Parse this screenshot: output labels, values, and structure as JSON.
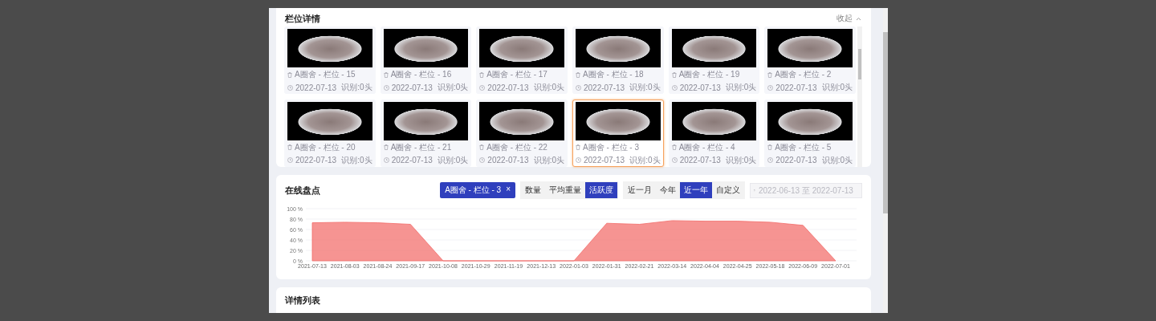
{
  "pen_details": {
    "title": "栏位详情",
    "collapse_label": "收起",
    "pens": [
      {
        "name": "A圈舍 - 栏位 - 15",
        "date": "2022-07-13",
        "count": "识别:0头",
        "selected": false
      },
      {
        "name": "A圈舍 - 栏位 - 16",
        "date": "2022-07-13",
        "count": "识别:0头",
        "selected": false
      },
      {
        "name": "A圈舍 - 栏位 - 17",
        "date": "2022-07-13",
        "count": "识别:0头",
        "selected": false
      },
      {
        "name": "A圈舍 - 栏位 - 18",
        "date": "2022-07-13",
        "count": "识别:0头",
        "selected": false
      },
      {
        "name": "A圈舍 - 栏位 - 19",
        "date": "2022-07-13",
        "count": "识别:0头",
        "selected": false
      },
      {
        "name": "A圈舍 - 栏位 - 2",
        "date": "2022-07-13",
        "count": "识别:0头",
        "selected": false
      },
      {
        "name": "A圈舍 - 栏位 - 20",
        "date": "2022-07-13",
        "count": "识别:0头",
        "selected": false
      },
      {
        "name": "A圈舍 - 栏位 - 21",
        "date": "2022-07-13",
        "count": "识别:0头",
        "selected": false
      },
      {
        "name": "A圈舍 - 栏位 - 22",
        "date": "2022-07-13",
        "count": "识别:0头",
        "selected": false
      },
      {
        "name": "A圈舍 - 栏位 - 3",
        "date": "2022-07-13",
        "count": "识别:0头",
        "selected": true
      },
      {
        "name": "A圈舍 - 栏位 - 4",
        "date": "2022-07-13",
        "count": "识别:0头",
        "selected": false
      },
      {
        "name": "A圈舍 - 栏位 - 5",
        "date": "2022-07-13",
        "count": "识别:0头",
        "selected": false
      }
    ]
  },
  "inventory": {
    "title": "在线盘点",
    "filter_chip": {
      "label": "A圈舍 - 栏位 - 3",
      "close": "×"
    },
    "metrics": [
      {
        "label": "数量",
        "selected": false
      },
      {
        "label": "平均重量",
        "selected": false
      },
      {
        "label": "活跃度",
        "selected": true
      }
    ],
    "ranges": [
      {
        "label": "近一月",
        "selected": false
      },
      {
        "label": "今年",
        "selected": false
      },
      {
        "label": "近一年",
        "selected": true
      },
      {
        "label": "自定义",
        "selected": false
      }
    ],
    "date_range": {
      "placeholder": "2022-06-13 至 2022-07-13"
    },
    "chart_data": {
      "type": "area",
      "ylim": [
        0,
        100
      ],
      "grid": true,
      "categories": [
        "2021-07-13",
        "2021-08-03",
        "2021-08-24",
        "2021-09-17",
        "2021-10-08",
        "2021-10-29",
        "2021-11-19",
        "2021-12-13",
        "2022-01-03",
        "2022-01-31",
        "2022-02-21",
        "2022-03-14",
        "2022-04-04",
        "2022-04-25",
        "2022-05-18",
        "2022-06-09",
        "2022-07-01"
      ],
      "yticks": [
        {
          "value": 0,
          "label": "0 %"
        },
        {
          "value": 20,
          "label": "20 %"
        },
        {
          "value": 40,
          "label": "40 %"
        },
        {
          "value": 60,
          "label": "60 %"
        },
        {
          "value": 80,
          "label": "80 %"
        },
        {
          "value": 100,
          "label": "100 %"
        }
      ],
      "series": [
        {
          "color": "#f36b68",
          "values": [
            73,
            74,
            73,
            70,
            0,
            0,
            0,
            0,
            0,
            72,
            70,
            77,
            76,
            76,
            74,
            68,
            0
          ]
        }
      ]
    }
  },
  "detail_list": {
    "title": "详情列表"
  }
}
